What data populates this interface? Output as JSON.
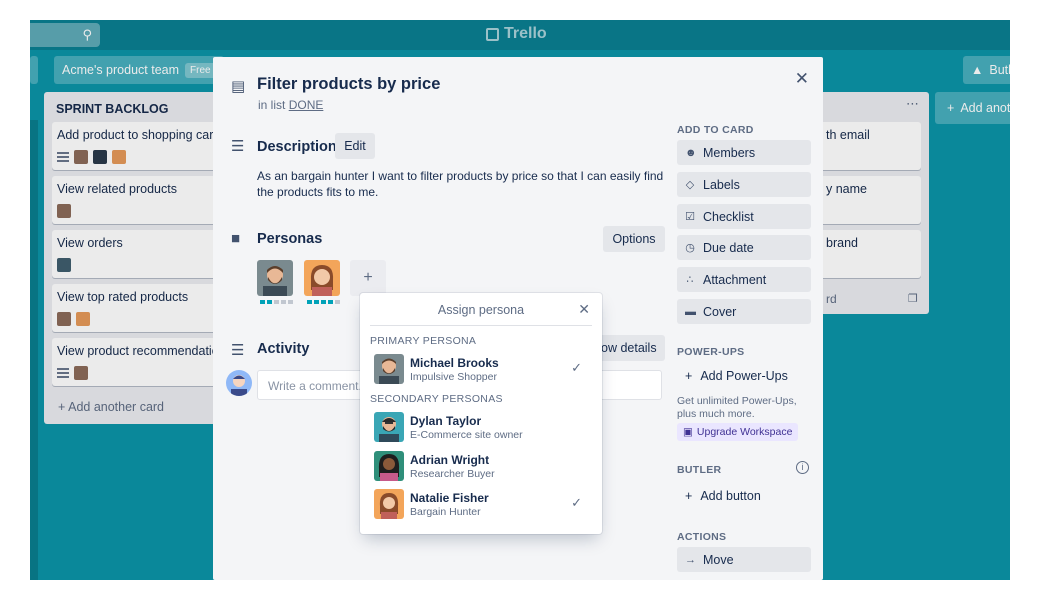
{
  "topbar": {
    "logo": "Trello",
    "search_icon": "search-icon"
  },
  "boardbar": {
    "team": "Acme's product team",
    "plan": "Free",
    "butler": "Butl"
  },
  "sprint_list": {
    "title": "SPRINT BACKLOG",
    "cards": [
      {
        "title": "Add product to shopping cart"
      },
      {
        "title": "View related products"
      },
      {
        "title": "View orders"
      },
      {
        "title": "View top rated products"
      },
      {
        "title": "View product recommendation"
      }
    ],
    "add_card": "Add another card"
  },
  "right_list": {
    "cards": [
      "th email",
      "y name",
      "brand"
    ],
    "footer": "rd"
  },
  "add_list": "Add anot",
  "modal": {
    "title": "Filter products by price",
    "in_list_prefix": "in list",
    "list_name": "DONE",
    "description": {
      "heading": "Description",
      "edit_label": "Edit",
      "text": "As an bargain hunter I want to filter products by price so that I can easily find the products fits to me."
    },
    "personas": {
      "heading": "Personas",
      "options_label": "Options",
      "add_label": "+",
      "avatars": [
        {
          "name": "Michael Brooks",
          "level": 2
        },
        {
          "name": "Natalie Fisher",
          "level": 4
        }
      ]
    },
    "activity": {
      "heading": "Activity",
      "show_details_label": "ow details",
      "comment_placeholder": "Write a comment..."
    },
    "close_icon": "close-icon"
  },
  "sidebar": {
    "add_to_card_heading": "ADD TO CARD",
    "add_to_card": [
      {
        "label": "Members",
        "icon": "person-icon"
      },
      {
        "label": "Labels",
        "icon": "tag-icon"
      },
      {
        "label": "Checklist",
        "icon": "checklist-icon"
      },
      {
        "label": "Due date",
        "icon": "clock-icon"
      },
      {
        "label": "Attachment",
        "icon": "paperclip-icon"
      },
      {
        "label": "Cover",
        "icon": "cover-icon"
      }
    ],
    "powerups_heading": "POWER-UPS",
    "add_powerups": "Add Power-Ups",
    "powerups_note": "Get unlimited Power-Ups, plus much more.",
    "upgrade": "Upgrade Workspace",
    "butler_heading": "BUTLER",
    "add_button": "Add button",
    "actions_heading": "ACTIONS",
    "move": "Move"
  },
  "assign_popover": {
    "title": "Assign persona",
    "primary_heading": "PRIMARY PERSONA",
    "secondary_heading": "SECONDARY PERSONAS",
    "personas": [
      {
        "name": "Michael Brooks",
        "role": "Impulsive Shopper",
        "checked": true
      },
      {
        "name": "Dylan Taylor",
        "role": "E-Commerce site owner",
        "checked": false
      },
      {
        "name": "Adrian Wright",
        "role": "Researcher Buyer",
        "checked": false
      },
      {
        "name": "Natalie Fisher",
        "role": "Bargain Hunter",
        "checked": true
      }
    ]
  },
  "colors": {
    "board_bg": "#0b94a8",
    "accent_teal": "#00a2b8",
    "upgrade_purple": "#eae6ff"
  }
}
